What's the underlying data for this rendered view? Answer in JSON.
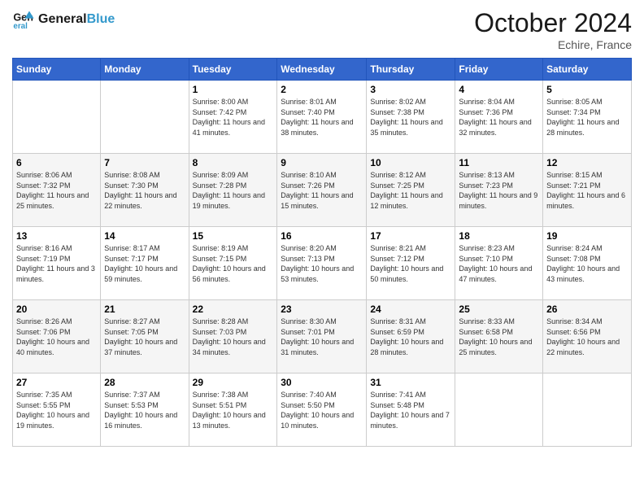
{
  "header": {
    "logo_line1": "General",
    "logo_line2": "Blue",
    "month": "October 2024",
    "location": "Echire, France"
  },
  "columns": [
    "Sunday",
    "Monday",
    "Tuesday",
    "Wednesday",
    "Thursday",
    "Friday",
    "Saturday"
  ],
  "weeks": [
    [
      {
        "day": "",
        "sunrise": "",
        "sunset": "",
        "daylight": ""
      },
      {
        "day": "",
        "sunrise": "",
        "sunset": "",
        "daylight": ""
      },
      {
        "day": "1",
        "sunrise": "Sunrise: 8:00 AM",
        "sunset": "Sunset: 7:42 PM",
        "daylight": "Daylight: 11 hours and 41 minutes."
      },
      {
        "day": "2",
        "sunrise": "Sunrise: 8:01 AM",
        "sunset": "Sunset: 7:40 PM",
        "daylight": "Daylight: 11 hours and 38 minutes."
      },
      {
        "day": "3",
        "sunrise": "Sunrise: 8:02 AM",
        "sunset": "Sunset: 7:38 PM",
        "daylight": "Daylight: 11 hours and 35 minutes."
      },
      {
        "day": "4",
        "sunrise": "Sunrise: 8:04 AM",
        "sunset": "Sunset: 7:36 PM",
        "daylight": "Daylight: 11 hours and 32 minutes."
      },
      {
        "day": "5",
        "sunrise": "Sunrise: 8:05 AM",
        "sunset": "Sunset: 7:34 PM",
        "daylight": "Daylight: 11 hours and 28 minutes."
      }
    ],
    [
      {
        "day": "6",
        "sunrise": "Sunrise: 8:06 AM",
        "sunset": "Sunset: 7:32 PM",
        "daylight": "Daylight: 11 hours and 25 minutes."
      },
      {
        "day": "7",
        "sunrise": "Sunrise: 8:08 AM",
        "sunset": "Sunset: 7:30 PM",
        "daylight": "Daylight: 11 hours and 22 minutes."
      },
      {
        "day": "8",
        "sunrise": "Sunrise: 8:09 AM",
        "sunset": "Sunset: 7:28 PM",
        "daylight": "Daylight: 11 hours and 19 minutes."
      },
      {
        "day": "9",
        "sunrise": "Sunrise: 8:10 AM",
        "sunset": "Sunset: 7:26 PM",
        "daylight": "Daylight: 11 hours and 15 minutes."
      },
      {
        "day": "10",
        "sunrise": "Sunrise: 8:12 AM",
        "sunset": "Sunset: 7:25 PM",
        "daylight": "Daylight: 11 hours and 12 minutes."
      },
      {
        "day": "11",
        "sunrise": "Sunrise: 8:13 AM",
        "sunset": "Sunset: 7:23 PM",
        "daylight": "Daylight: 11 hours and 9 minutes."
      },
      {
        "day": "12",
        "sunrise": "Sunrise: 8:15 AM",
        "sunset": "Sunset: 7:21 PM",
        "daylight": "Daylight: 11 hours and 6 minutes."
      }
    ],
    [
      {
        "day": "13",
        "sunrise": "Sunrise: 8:16 AM",
        "sunset": "Sunset: 7:19 PM",
        "daylight": "Daylight: 11 hours and 3 minutes."
      },
      {
        "day": "14",
        "sunrise": "Sunrise: 8:17 AM",
        "sunset": "Sunset: 7:17 PM",
        "daylight": "Daylight: 10 hours and 59 minutes."
      },
      {
        "day": "15",
        "sunrise": "Sunrise: 8:19 AM",
        "sunset": "Sunset: 7:15 PM",
        "daylight": "Daylight: 10 hours and 56 minutes."
      },
      {
        "day": "16",
        "sunrise": "Sunrise: 8:20 AM",
        "sunset": "Sunset: 7:13 PM",
        "daylight": "Daylight: 10 hours and 53 minutes."
      },
      {
        "day": "17",
        "sunrise": "Sunrise: 8:21 AM",
        "sunset": "Sunset: 7:12 PM",
        "daylight": "Daylight: 10 hours and 50 minutes."
      },
      {
        "day": "18",
        "sunrise": "Sunrise: 8:23 AM",
        "sunset": "Sunset: 7:10 PM",
        "daylight": "Daylight: 10 hours and 47 minutes."
      },
      {
        "day": "19",
        "sunrise": "Sunrise: 8:24 AM",
        "sunset": "Sunset: 7:08 PM",
        "daylight": "Daylight: 10 hours and 43 minutes."
      }
    ],
    [
      {
        "day": "20",
        "sunrise": "Sunrise: 8:26 AM",
        "sunset": "Sunset: 7:06 PM",
        "daylight": "Daylight: 10 hours and 40 minutes."
      },
      {
        "day": "21",
        "sunrise": "Sunrise: 8:27 AM",
        "sunset": "Sunset: 7:05 PM",
        "daylight": "Daylight: 10 hours and 37 minutes."
      },
      {
        "day": "22",
        "sunrise": "Sunrise: 8:28 AM",
        "sunset": "Sunset: 7:03 PM",
        "daylight": "Daylight: 10 hours and 34 minutes."
      },
      {
        "day": "23",
        "sunrise": "Sunrise: 8:30 AM",
        "sunset": "Sunset: 7:01 PM",
        "daylight": "Daylight: 10 hours and 31 minutes."
      },
      {
        "day": "24",
        "sunrise": "Sunrise: 8:31 AM",
        "sunset": "Sunset: 6:59 PM",
        "daylight": "Daylight: 10 hours and 28 minutes."
      },
      {
        "day": "25",
        "sunrise": "Sunrise: 8:33 AM",
        "sunset": "Sunset: 6:58 PM",
        "daylight": "Daylight: 10 hours and 25 minutes."
      },
      {
        "day": "26",
        "sunrise": "Sunrise: 8:34 AM",
        "sunset": "Sunset: 6:56 PM",
        "daylight": "Daylight: 10 hours and 22 minutes."
      }
    ],
    [
      {
        "day": "27",
        "sunrise": "Sunrise: 7:35 AM",
        "sunset": "Sunset: 5:55 PM",
        "daylight": "Daylight: 10 hours and 19 minutes."
      },
      {
        "day": "28",
        "sunrise": "Sunrise: 7:37 AM",
        "sunset": "Sunset: 5:53 PM",
        "daylight": "Daylight: 10 hours and 16 minutes."
      },
      {
        "day": "29",
        "sunrise": "Sunrise: 7:38 AM",
        "sunset": "Sunset: 5:51 PM",
        "daylight": "Daylight: 10 hours and 13 minutes."
      },
      {
        "day": "30",
        "sunrise": "Sunrise: 7:40 AM",
        "sunset": "Sunset: 5:50 PM",
        "daylight": "Daylight: 10 hours and 10 minutes."
      },
      {
        "day": "31",
        "sunrise": "Sunrise: 7:41 AM",
        "sunset": "Sunset: 5:48 PM",
        "daylight": "Daylight: 10 hours and 7 minutes."
      },
      {
        "day": "",
        "sunrise": "",
        "sunset": "",
        "daylight": ""
      },
      {
        "day": "",
        "sunrise": "",
        "sunset": "",
        "daylight": ""
      }
    ]
  ]
}
